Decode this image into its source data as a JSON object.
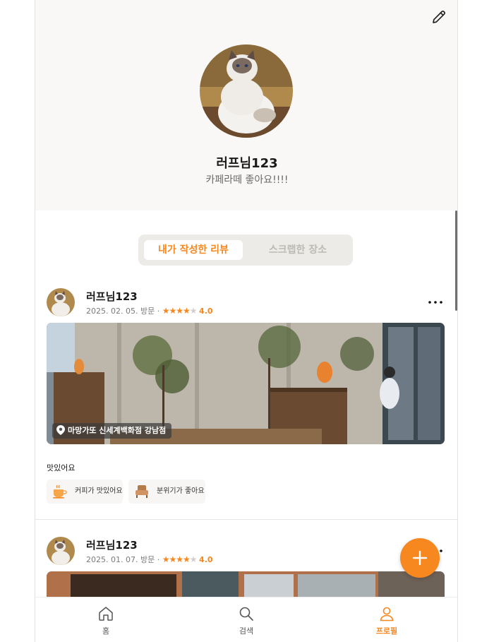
{
  "profile": {
    "name": "러프님123",
    "bio": "카페라떼 좋아요!!!!"
  },
  "tabs": [
    {
      "label": "내가 작성한 리뷰",
      "active": true
    },
    {
      "label": "스크랩한 장소",
      "active": false
    }
  ],
  "reviews": [
    {
      "user": "러프님123",
      "visit": "2025. 02. 05. 방문",
      "separator": "·",
      "rating": "4.0",
      "stars_filled": 4,
      "place": "마망가또 신세계백화점 강남점",
      "text": "맛있어요",
      "tags": [
        {
          "icon": "coffee-cup-icon",
          "label": "커피가 맛있어요"
        },
        {
          "icon": "armchair-icon",
          "label": "분위기가 좋아요"
        }
      ]
    },
    {
      "user": "러프님123",
      "visit": "2025. 01. 07. 방문",
      "separator": "·",
      "rating": "4.0",
      "stars_filled": 4
    }
  ],
  "nav": [
    {
      "icon": "home-icon",
      "label": "홈",
      "active": false
    },
    {
      "icon": "search-icon",
      "label": "검색",
      "active": false
    },
    {
      "icon": "user-icon",
      "label": "프로필",
      "active": true
    }
  ],
  "colors": {
    "accent": "#f7871f",
    "header_bg": "#f9f8f6",
    "tab_bg": "#ecebe8"
  }
}
